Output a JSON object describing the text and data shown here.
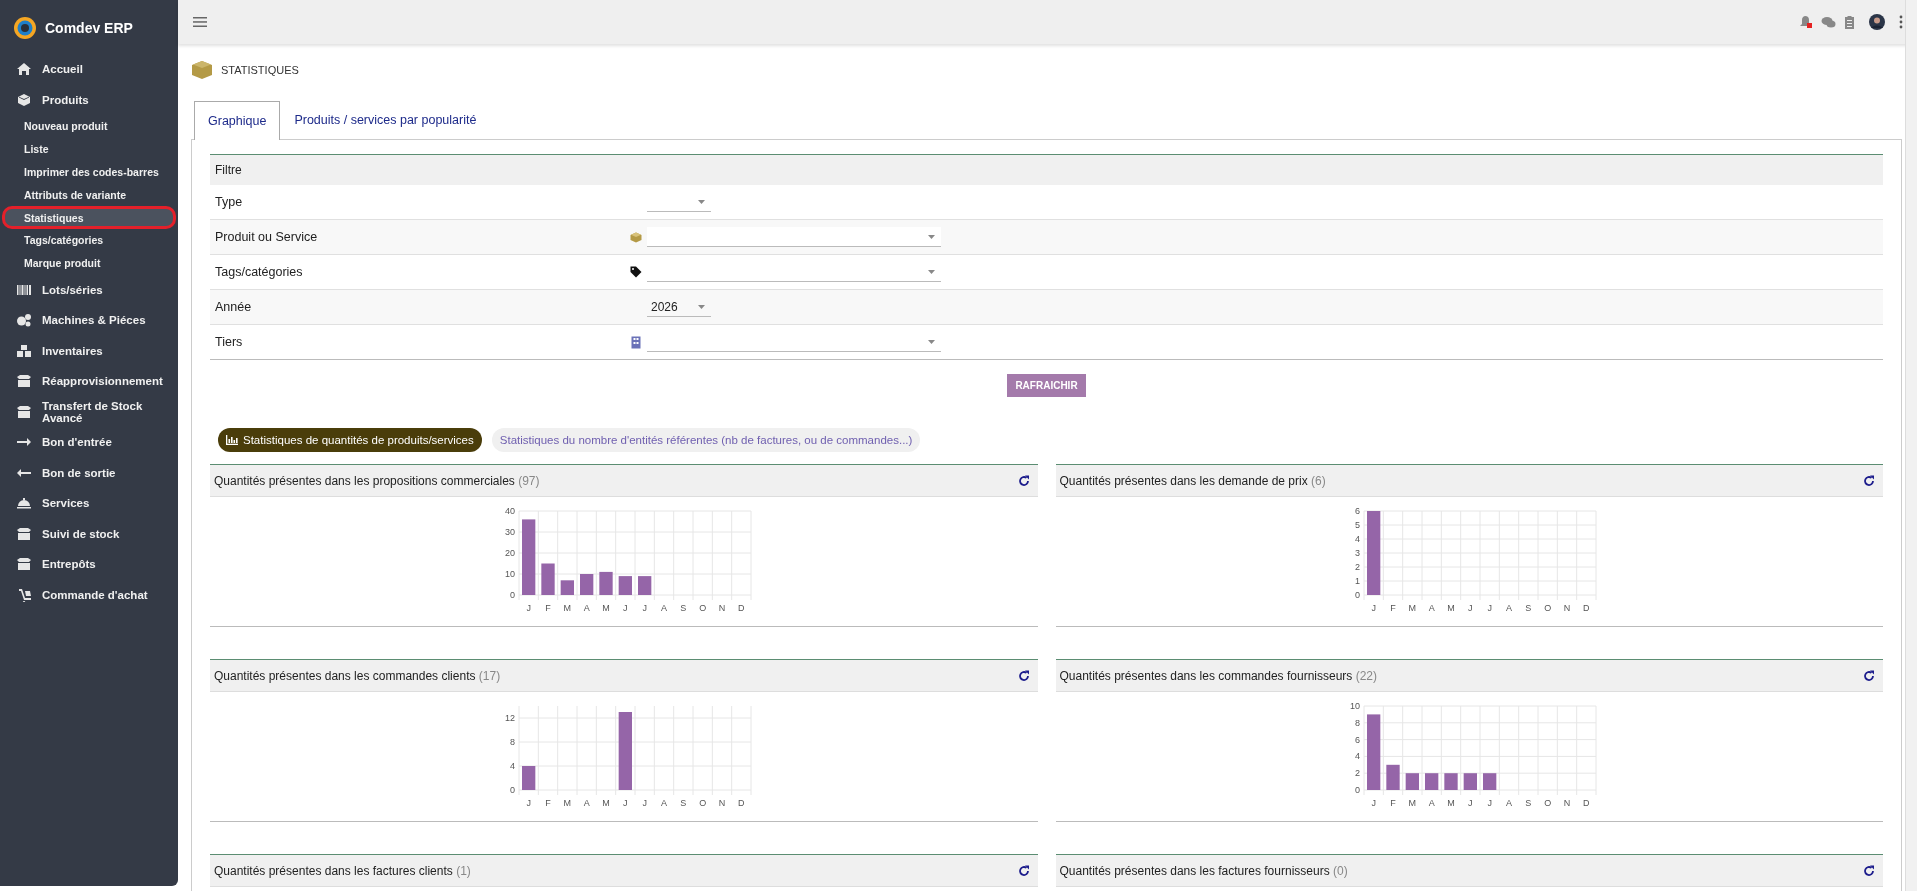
{
  "app": {
    "name": "Comdev ERP"
  },
  "sidebar": {
    "items": [
      {
        "label": "Accueil",
        "kind": "main",
        "selected": false
      },
      {
        "label": "Produits",
        "kind": "main",
        "selected": false
      },
      {
        "label": "Nouveau produit",
        "kind": "sub",
        "selected": false
      },
      {
        "label": "Liste",
        "kind": "sub",
        "selected": false
      },
      {
        "label": "Imprimer des codes-barres",
        "kind": "sub",
        "selected": false
      },
      {
        "label": "Attributs de variante",
        "kind": "sub",
        "selected": false
      },
      {
        "label": "Statistiques",
        "kind": "sub",
        "selected": true
      },
      {
        "label": "Tags/catégories",
        "kind": "sub",
        "selected": false
      },
      {
        "label": "Marque produit",
        "kind": "sub",
        "selected": false
      },
      {
        "label": "Lots/séries",
        "kind": "main",
        "selected": false
      },
      {
        "label": "Machines & Piéces",
        "kind": "main",
        "selected": false
      },
      {
        "label": "Inventaires",
        "kind": "main",
        "selected": false
      },
      {
        "label": "Réapprovisionnement",
        "kind": "main",
        "selected": false
      },
      {
        "label": "Transfert de Stock Avancé",
        "kind": "main",
        "selected": false
      },
      {
        "label": "Bon d'entrée",
        "kind": "main",
        "selected": false
      },
      {
        "label": "Bon de sortie",
        "kind": "main",
        "selected": false
      },
      {
        "label": "Services",
        "kind": "main",
        "selected": false
      },
      {
        "label": "Suivi de stock",
        "kind": "main",
        "selected": false
      },
      {
        "label": "Entrepôts",
        "kind": "main",
        "selected": false
      },
      {
        "label": "Commande d'achat",
        "kind": "main",
        "selected": false
      }
    ]
  },
  "page": {
    "title": "STATISTIQUES"
  },
  "tabs": [
    {
      "label": "Graphique",
      "selected": true
    },
    {
      "label": "Produits / services par popularité",
      "selected": false
    }
  ],
  "filter": {
    "title": "Filtre",
    "rows": [
      {
        "label": "Type",
        "kind": "small"
      },
      {
        "label": "Produit ou Service",
        "kind": "wide"
      },
      {
        "label": "Tags/catégories",
        "kind": "wide"
      },
      {
        "label": "Année",
        "kind": "small",
        "value": "2026"
      },
      {
        "label": "Tiers",
        "kind": "wide"
      }
    ],
    "button": "RAFRAICHIR"
  },
  "modes": [
    {
      "label": "Statistiques de quantités de produits/services",
      "selected": true
    },
    {
      "label": "Statistiques du nombre d'entités référentes (nb de factures, ou de commandes...)",
      "selected": false
    }
  ],
  "panels": [
    {
      "title": "Quantités présentes dans les propositions commerciales",
      "count": "(97)",
      "chart_data": {
        "type": "bar",
        "categories": [
          "J",
          "F",
          "M",
          "A",
          "M",
          "J",
          "J",
          "A",
          "S",
          "O",
          "N",
          "D"
        ],
        "values": [
          36,
          15,
          7,
          10,
          11,
          9,
          9,
          0,
          0,
          0,
          0,
          0
        ],
        "grid": true,
        "ylim": [
          0,
          40
        ],
        "yticks": [
          0,
          10,
          20,
          30,
          40
        ]
      }
    },
    {
      "title": "Quantités présentes dans les demande de prix",
      "count": "(6)",
      "chart_data": {
        "type": "bar",
        "categories": [
          "J",
          "F",
          "M",
          "A",
          "M",
          "J",
          "J",
          "A",
          "S",
          "O",
          "N",
          "D"
        ],
        "values": [
          6,
          0,
          0,
          0,
          0,
          0,
          0,
          0,
          0,
          0,
          0,
          0
        ],
        "grid": true,
        "ylim": [
          0,
          6
        ],
        "yticks": [
          0,
          1,
          2,
          3,
          4,
          5,
          6
        ]
      }
    },
    {
      "title": "Quantités présentes dans les commandes clients",
      "count": "(17)",
      "chart_data": {
        "type": "bar",
        "categories": [
          "J",
          "F",
          "M",
          "A",
          "M",
          "J",
          "J",
          "A",
          "S",
          "O",
          "N",
          "D"
        ],
        "values": [
          4,
          0,
          0,
          0,
          0,
          13,
          0,
          0,
          0,
          0,
          0,
          0
        ],
        "grid": true,
        "ylim": [
          0,
          14
        ],
        "yticks": [
          0,
          4,
          8,
          12
        ]
      }
    },
    {
      "title": "Quantités présentes dans les commandes fournisseurs",
      "count": "(22)",
      "chart_data": {
        "type": "bar",
        "categories": [
          "J",
          "F",
          "M",
          "A",
          "M",
          "J",
          "J",
          "A",
          "S",
          "O",
          "N",
          "D"
        ],
        "values": [
          9,
          3,
          2,
          2,
          2,
          2,
          2,
          0,
          0,
          0,
          0,
          0
        ],
        "grid": true,
        "ylim": [
          0,
          10
        ],
        "yticks": [
          0,
          2,
          4,
          6,
          8,
          10
        ]
      }
    },
    {
      "title": "Quantités présentes dans les factures clients",
      "count": "(1)"
    },
    {
      "title": "Quantités présentes dans les factures fournisseurs",
      "count": "(0)"
    }
  ]
}
